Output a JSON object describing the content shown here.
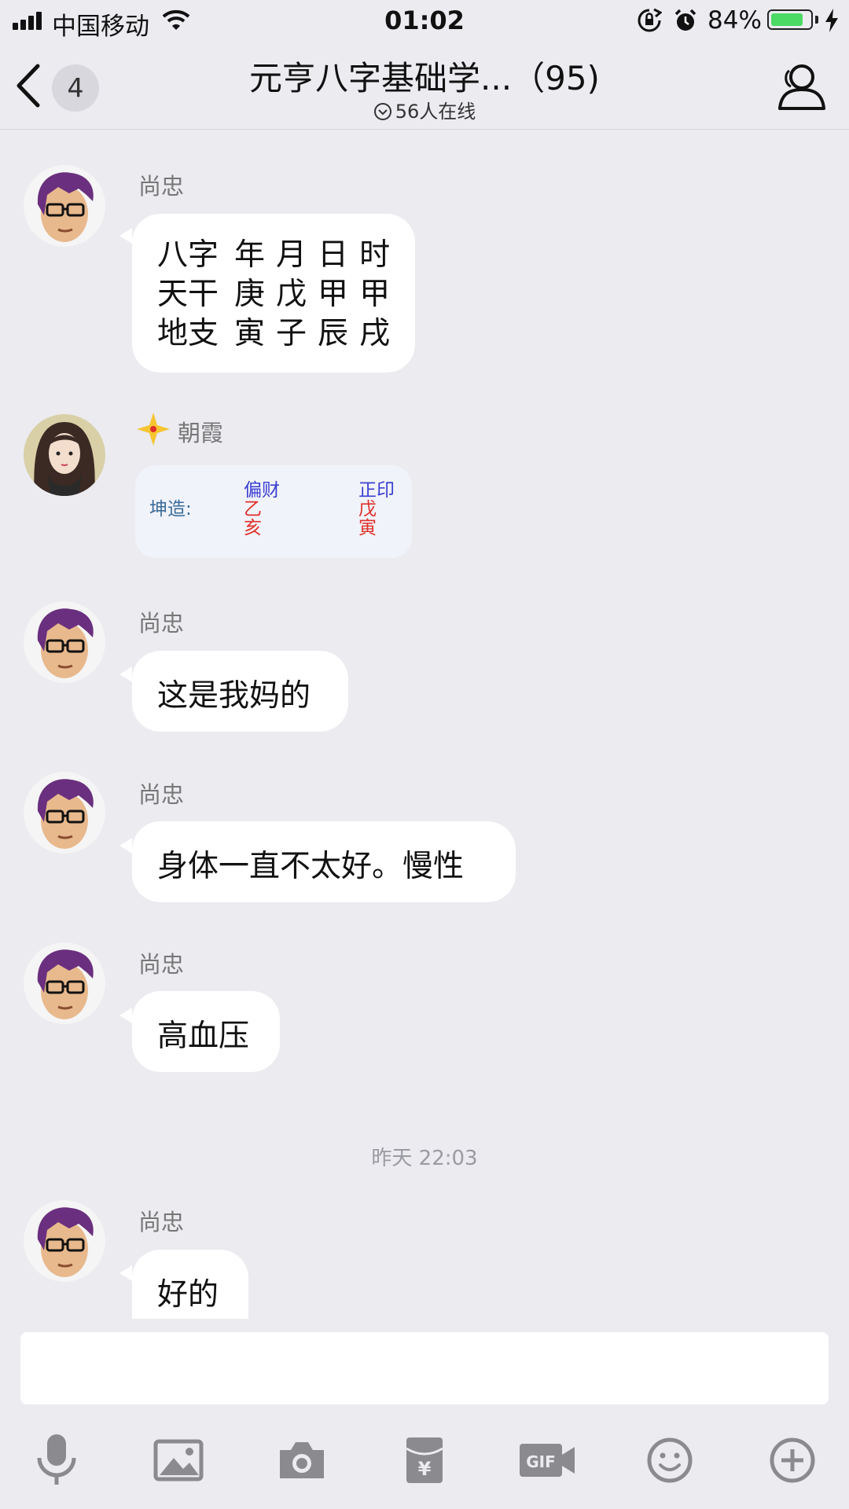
{
  "status_bar": {
    "carrier": "中国移动",
    "time": "01:02",
    "battery_percent_text": "84%",
    "battery_level": 0.84
  },
  "nav": {
    "back_badge": "4",
    "title": "元亨八字基础学...（95)",
    "online": "56人在线"
  },
  "messages": [
    {
      "sender": "尚忠",
      "type": "table",
      "rows": [
        [
          "八字",
          "年",
          "月",
          "日",
          "时"
        ],
        [
          "天干",
          "庚",
          "戊",
          "甲",
          "甲"
        ],
        [
          "地支",
          "寅",
          "子",
          "辰",
          "戌"
        ]
      ]
    },
    {
      "sender": "朝霞",
      "type": "image",
      "image": {
        "label": "坤造:",
        "col1": [
          "偏财",
          "乙",
          "亥"
        ],
        "col2": [
          "正印",
          "戊",
          "寅"
        ]
      }
    },
    {
      "sender": "尚忠",
      "type": "text",
      "text": "这是我妈的"
    },
    {
      "sender": "尚忠",
      "type": "text",
      "text": "身体一直不太好。慢性"
    },
    {
      "sender": "尚忠",
      "type": "text",
      "text": "高血压"
    },
    {
      "sender": "尚忠",
      "type": "text",
      "text": "好的"
    }
  ],
  "timestamp": "昨天 22:03",
  "input": {
    "value": ""
  },
  "toolbar": [
    "mic-icon",
    "image-icon",
    "camera-icon",
    "red-packet-icon",
    "gif-icon",
    "emoji-icon",
    "plus-icon"
  ],
  "colors": {
    "background": "#ebebf0",
    "bubble": "#ffffff",
    "battery": "#4cd964",
    "avatar_hair": "#6a2f7e",
    "image_blue": "#3a3fd0",
    "image_red": "#e0302a"
  }
}
